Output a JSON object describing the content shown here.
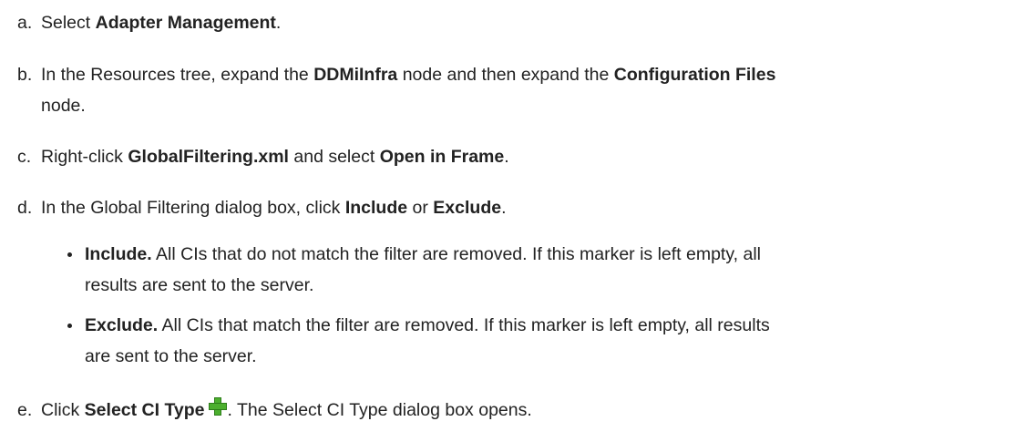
{
  "steps": {
    "a": {
      "letter": "a.",
      "pre": "Select ",
      "b1": "Adapter Management",
      "post": "."
    },
    "b": {
      "letter": "b.",
      "pre": "In the Resources tree, expand the ",
      "b1": "DDMiInfra",
      "mid": " node and then expand the ",
      "b2": "Configuration Files",
      "line2": "node."
    },
    "c": {
      "letter": "c.",
      "pre": "Right-click ",
      "b1": "GlobalFiltering.xml",
      "mid": " and select ",
      "b2": "Open in Frame",
      "post": "."
    },
    "d": {
      "letter": "d.",
      "pre": "In the Global Filtering dialog box, click ",
      "b1": "Include",
      "mid": " or ",
      "b2": "Exclude",
      "post": ".",
      "bullets": [
        {
          "bold": "Include.",
          "line1": " All CIs that do not match the filter are removed. If this marker is left empty, all",
          "line2": "results are sent to the server."
        },
        {
          "bold": "Exclude.",
          "line1": " All CIs that match the filter are removed. If this marker is left empty, all results",
          "line2": "are sent to the server."
        }
      ]
    },
    "e": {
      "letter": "e.",
      "pre": "Click ",
      "b1": "Select CI Type",
      "icon": "green-plus-icon",
      "post": ". The Select CI Type dialog box opens."
    }
  }
}
